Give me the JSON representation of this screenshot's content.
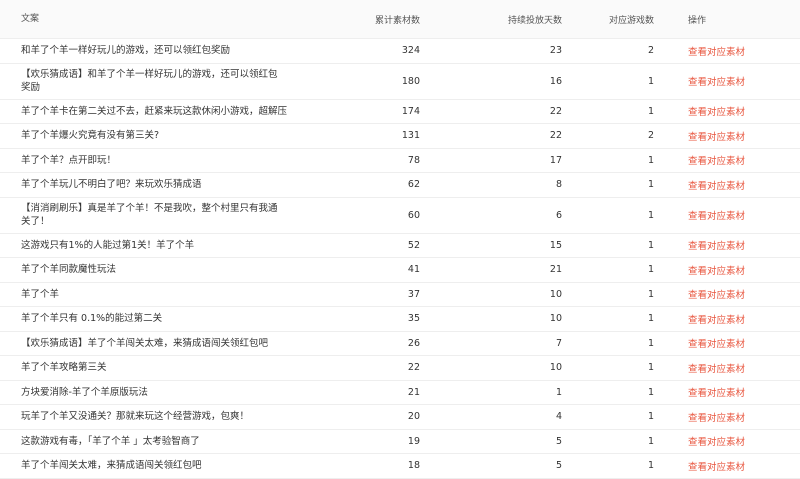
{
  "table": {
    "headers": [
      "文案",
      "累计素材数",
      "持续投放天数",
      "对应游戏数",
      "操作"
    ],
    "rows": [
      {
        "text": "和羊了个羊一样好玩儿的游戏，还可以领红包奖励",
        "materials": "324",
        "days": "23",
        "games": "2",
        "action": "查看对应素材"
      },
      {
        "text": "【欢乐猜成语】和羊了个羊一样好玩儿的游戏，还可以领红包奖励",
        "materials": "180",
        "days": "16",
        "games": "1",
        "action": "查看对应素材"
      },
      {
        "text": "羊了个羊卡在第二关过不去，赶紧来玩这款休闲小游戏，超解压",
        "materials": "174",
        "days": "22",
        "games": "1",
        "action": "查看对应素材"
      },
      {
        "text": "羊了个羊爆火究竟有没有第三关?",
        "materials": "131",
        "days": "22",
        "games": "2",
        "action": "查看对应素材"
      },
      {
        "text": "羊了个羊？点开即玩！",
        "materials": "78",
        "days": "17",
        "games": "1",
        "action": "查看对应素材"
      },
      {
        "text": "羊了个羊玩儿不明白了吧？来玩欢乐猜成语",
        "materials": "62",
        "days": "8",
        "games": "1",
        "action": "查看对应素材"
      },
      {
        "text": "【消消刷刷乐】真是羊了个羊！不是我吹，整个村里只有我通关了！",
        "materials": "60",
        "days": "6",
        "games": "1",
        "action": "查看对应素材"
      },
      {
        "text": "这游戏只有1%的人能过第1关！羊了个羊",
        "materials": "52",
        "days": "15",
        "games": "1",
        "action": "查看对应素材"
      },
      {
        "text": "羊了个羊同款魔性玩法",
        "materials": "41",
        "days": "21",
        "games": "1",
        "action": "查看对应素材"
      },
      {
        "text": "羊了个羊",
        "materials": "37",
        "days": "10",
        "games": "1",
        "action": "查看对应素材"
      },
      {
        "text": "羊了个羊只有 0.1%的能过第二关",
        "materials": "35",
        "days": "10",
        "games": "1",
        "action": "查看对应素材"
      },
      {
        "text": "【欢乐猜成语】羊了个羊闯关太难，来猜成语闯关领红包吧",
        "materials": "26",
        "days": "7",
        "games": "1",
        "action": "查看对应素材"
      },
      {
        "text": "羊了个羊攻略第三关",
        "materials": "22",
        "days": "10",
        "games": "1",
        "action": "查看对应素材"
      },
      {
        "text": "方块爱消除-羊了个羊原版玩法",
        "materials": "21",
        "days": "1",
        "games": "1",
        "action": "查看对应素材"
      },
      {
        "text": "玩羊了个羊又没通关？那就来玩这个经营游戏，包爽！",
        "materials": "20",
        "days": "4",
        "games": "1",
        "action": "查看对应素材"
      },
      {
        "text": "这款游戏有毒，「羊了个羊 」太考验智商了",
        "materials": "19",
        "days": "5",
        "games": "1",
        "action": "查看对应素材"
      },
      {
        "text": "羊了个羊闯关太难，来猜成语闯关领红包吧",
        "materials": "18",
        "days": "5",
        "games": "1",
        "action": "查看对应素材"
      }
    ]
  }
}
